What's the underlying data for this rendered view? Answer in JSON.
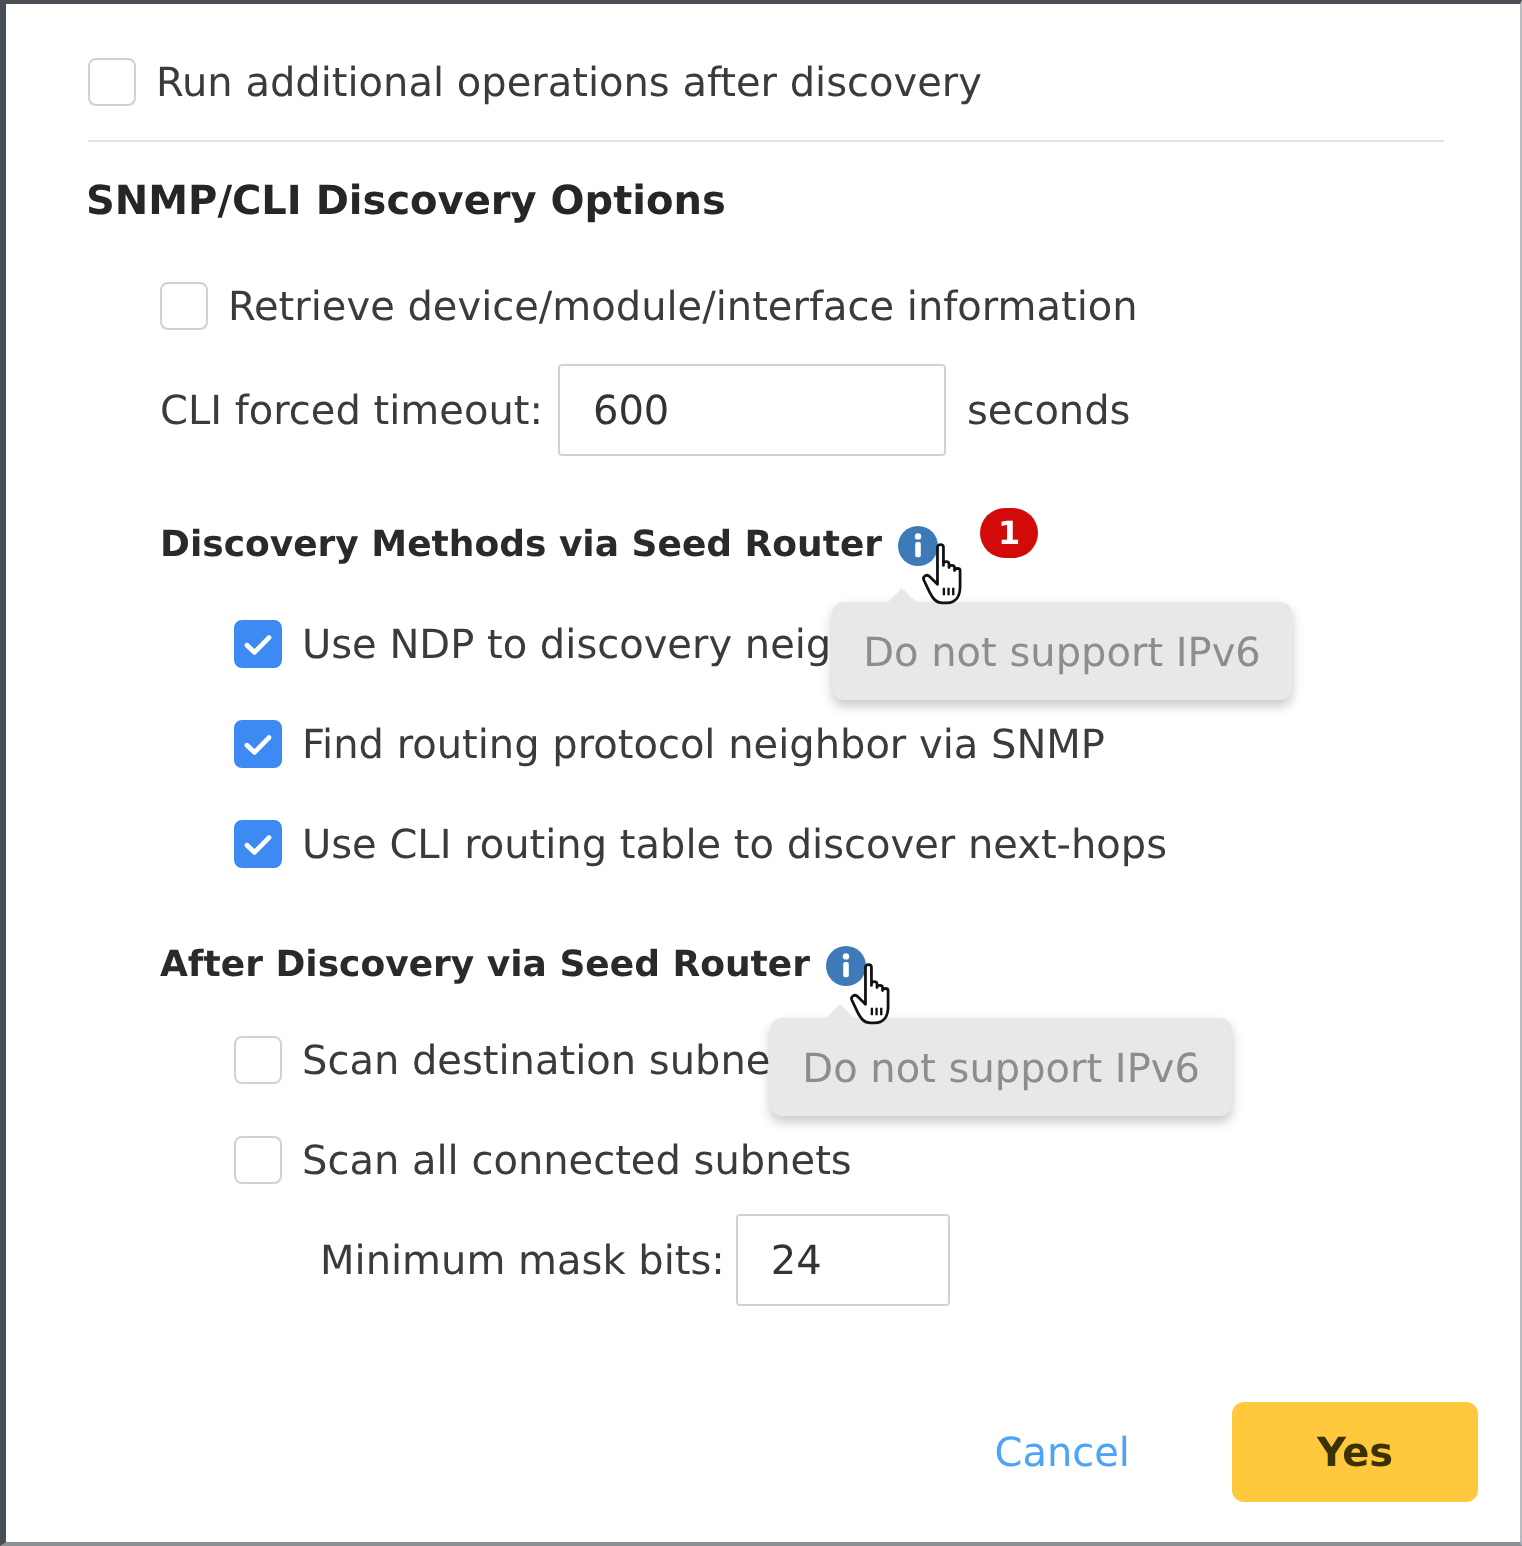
{
  "run_after": {
    "label": "Run additional operations after discovery",
    "checked": false
  },
  "snmp_cli": {
    "title": "SNMP/CLI Discovery Options",
    "retrieve": {
      "label": "Retrieve device/module/interface information",
      "checked": false
    },
    "timeout": {
      "label": "CLI forced timeout:",
      "value": "600",
      "unit": "seconds"
    },
    "groups": [
      {
        "title": "Discovery Methods via Seed Router",
        "tooltip": "Do not support IPv6",
        "badge": "1",
        "items": [
          {
            "label": "Use NDP to discovery neig",
            "checked": true
          },
          {
            "label": "Find routing protocol neighbor via SNMP",
            "checked": true
          },
          {
            "label": "Use CLI routing table to discover next-hops",
            "checked": true
          }
        ]
      },
      {
        "title": "After Discovery via Seed Router",
        "tooltip": "Do not support IPv6",
        "items": [
          {
            "label": "Scan destination subne",
            "checked": false
          },
          {
            "label": "Scan all connected subnets",
            "checked": false
          }
        ],
        "mask_bits": {
          "label": "Minimum mask bits:",
          "value": "24"
        }
      }
    ]
  },
  "buttons": [
    {
      "label": "Cancel",
      "kind": "link"
    },
    {
      "label": "Yes",
      "kind": "primary"
    }
  ]
}
